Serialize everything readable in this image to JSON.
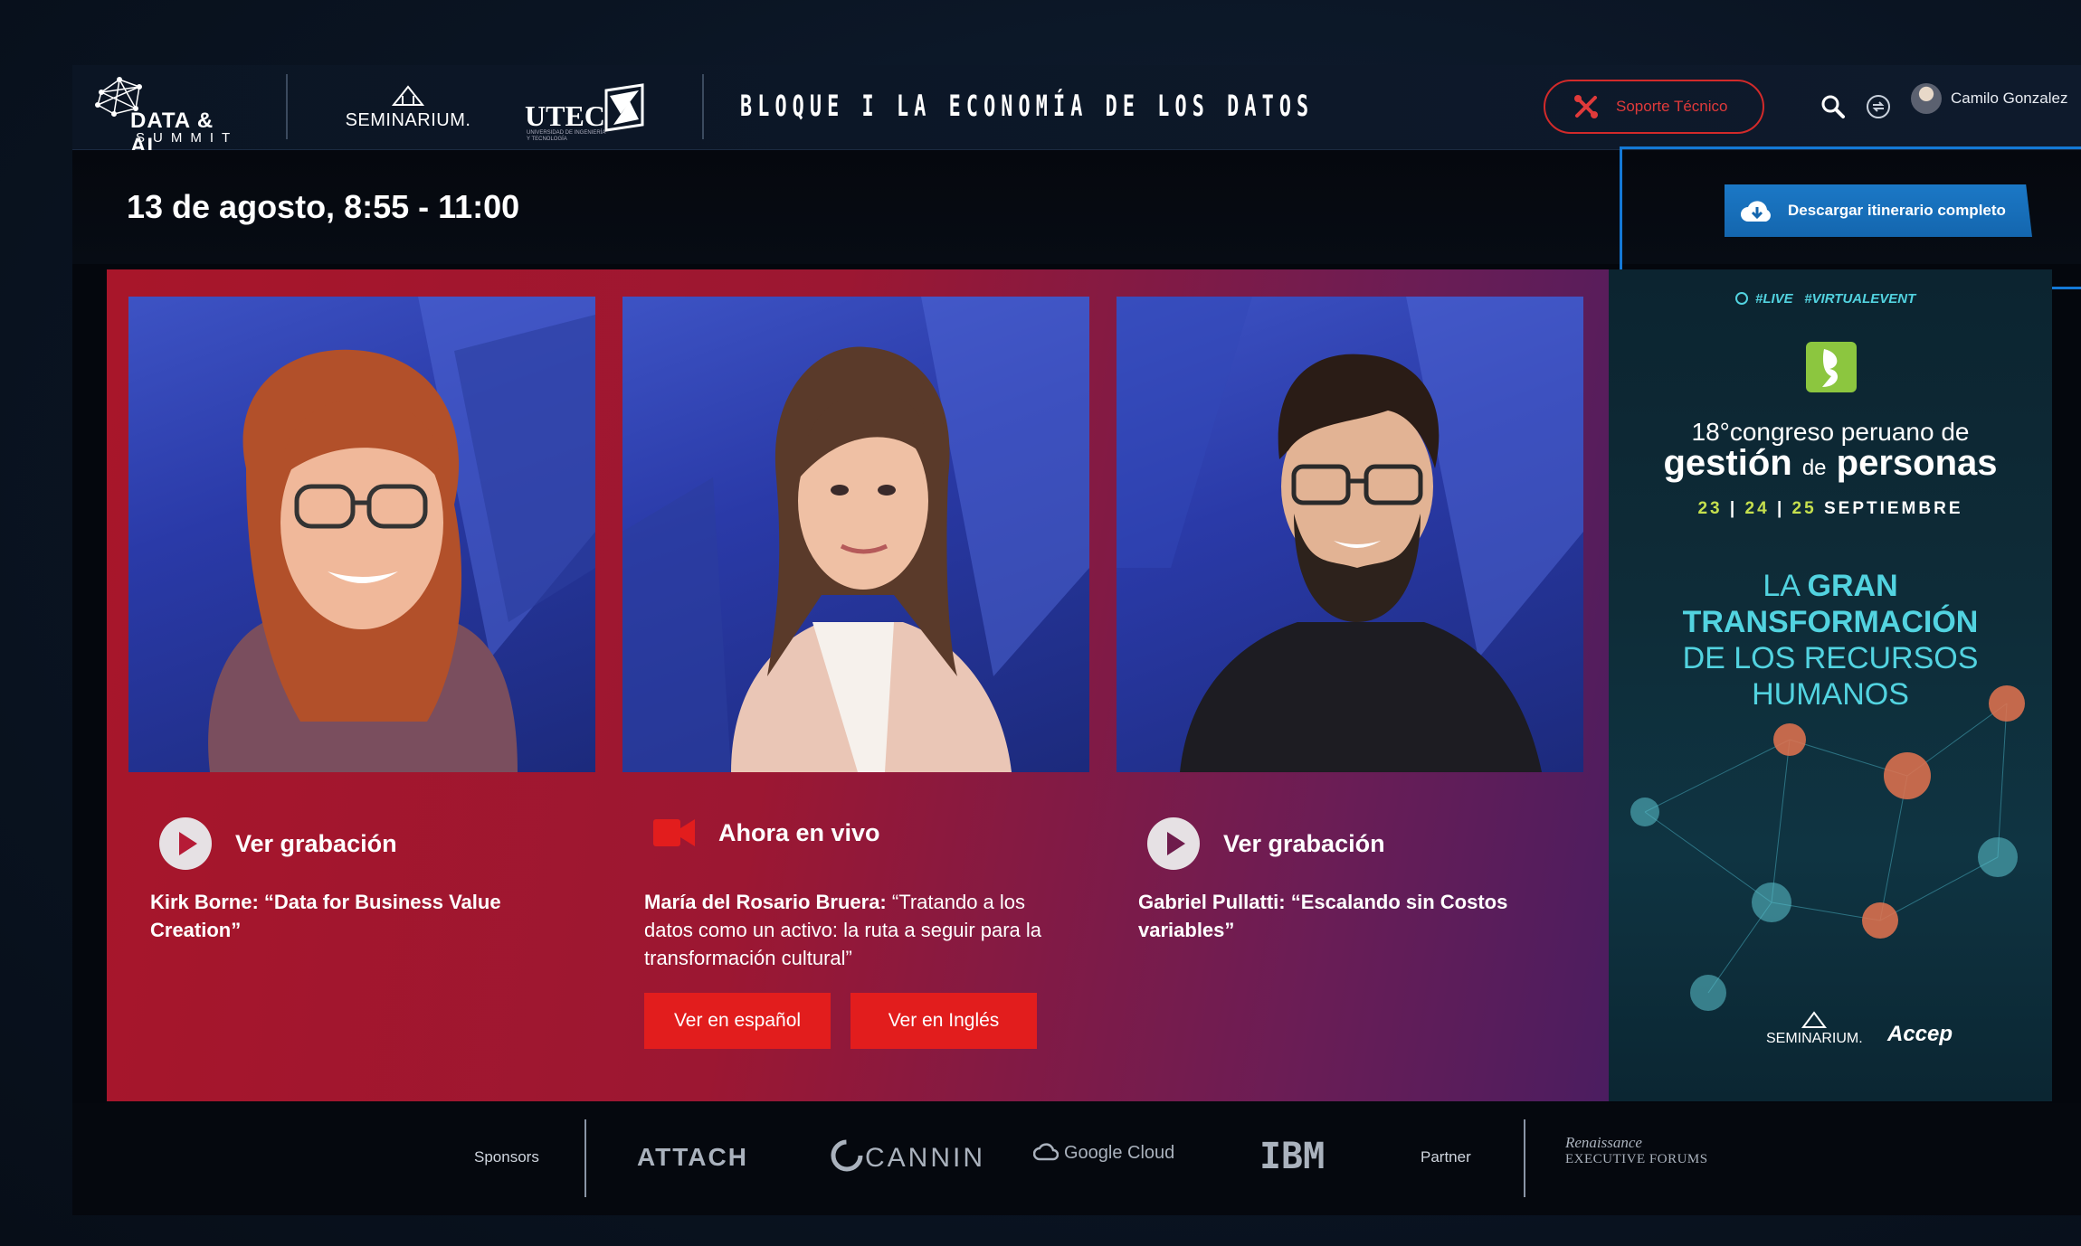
{
  "header": {
    "data_logo_line1": "DATA & AI",
    "data_logo_line2": "SUMMIT",
    "seminarium": "SEMINARIUM.",
    "utec": "UTEC",
    "utec_sub": "UNIVERSIDAD DE INGENIERÍA Y TECNOLOGÍA",
    "block_title": "BLOQUE I LA ECONOMÍA DE LOS DATOS",
    "support_label": "Soporte Técnico",
    "user_name": "Camilo Gonzalez",
    "icons": [
      "search-icon",
      "refresh-icon",
      "avatar"
    ]
  },
  "session": {
    "date_label": "13 de agosto, 8:55 - 11:00",
    "download_label": "Descargar itinerario completo"
  },
  "talks": [
    {
      "status": "Ver grabación",
      "status_icon": "play-icon",
      "speaker": "Kirk Borne:",
      "title": "“Data for Business Value Creation”"
    },
    {
      "status": "Ahora en vivo",
      "status_icon": "video-camera-icon",
      "speaker": "María del Rosario Bruera:",
      "title": "“Tratando a los datos como un activo: la ruta a seguir para la transformación cultural”",
      "buttons": [
        "Ver en español",
        "Ver en Inglés"
      ]
    },
    {
      "status": "Ver grabación",
      "status_icon": "play-icon",
      "speaker": "Gabriel Pullatti:",
      "title": "“Escalando sin Costos variables”"
    }
  ],
  "ad": {
    "tag_live": "#LIVE",
    "tag_virtual": "#VIRTUALEVENT",
    "ordinal": "18°",
    "line1": "congreso peruano de",
    "line2_a": "gestión",
    "line2_b": "de",
    "line2_c": "personas",
    "date_23": "23",
    "date_24": "24",
    "date_25": "25",
    "month": "SEPTIEMBRE",
    "headline_1": "LA",
    "headline_2": "GRAN",
    "headline_3": "TRANSFORMACIÓN",
    "headline_4": "DE LOS RECURSOS",
    "headline_5": "HUMANOS",
    "footer_left": "SEMINARIUM.",
    "footer_right": "Accep"
  },
  "sponsors": {
    "label": "Sponsors",
    "items": [
      "ATTACH",
      "CANNIN",
      "Google Cloud",
      "IBM"
    ],
    "partner_label": "Partner",
    "partner_line1": "Renaissance",
    "partner_line2": "EXECUTIVE FORUMS"
  },
  "colors": {
    "accent_red": "#e21d1d",
    "accent_blue": "#1479d6",
    "live_cyan": "#52d3e0",
    "ad_lime": "#c6e04e"
  }
}
